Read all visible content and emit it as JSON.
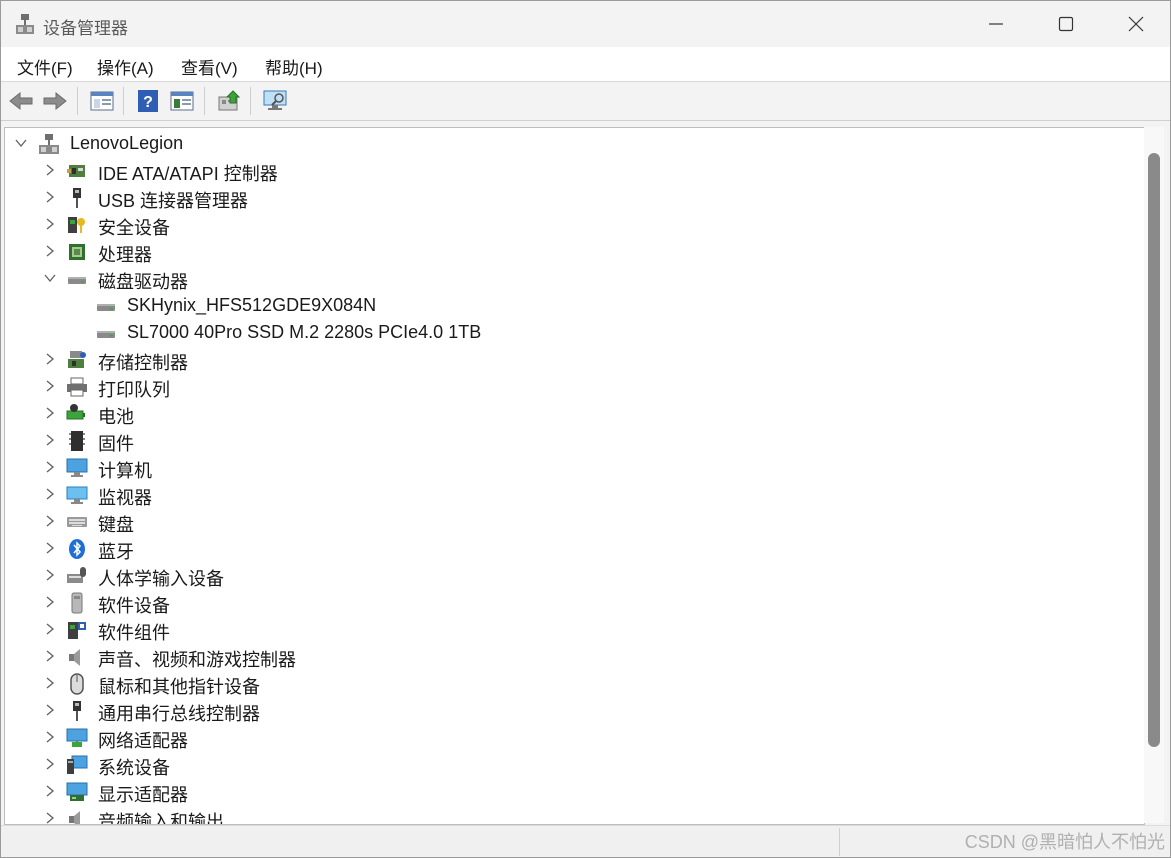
{
  "window": {
    "title": "设备管理器"
  },
  "menu": [
    "文件(F)",
    "操作(A)",
    "查看(V)",
    "帮助(H)"
  ],
  "toolbar": [
    "back-icon",
    "forward-icon",
    "properties-pane-icon",
    "help-icon",
    "console-view-icon",
    "update-driver-icon",
    "scan-hardware-icon"
  ],
  "tree": {
    "root": "LenovoLegion",
    "categories": [
      {
        "label": "IDE ATA/ATAPI 控制器",
        "icon": "ide-controller-icon",
        "expanded": false
      },
      {
        "label": "USB 连接器管理器",
        "icon": "usb-icon",
        "expanded": false
      },
      {
        "label": "安全设备",
        "icon": "security-device-icon",
        "expanded": false
      },
      {
        "label": "处理器",
        "icon": "processor-icon",
        "expanded": false
      },
      {
        "label": "磁盘驱动器",
        "icon": "disk-drive-icon",
        "expanded": true,
        "children": [
          "SKHynix_HFS512GDE9X084N",
          "SL7000 40Pro SSD M.2 2280s PCIe4.0 1TB"
        ]
      },
      {
        "label": "存储控制器",
        "icon": "storage-controller-icon",
        "expanded": false
      },
      {
        "label": "打印队列",
        "icon": "printer-icon",
        "expanded": false
      },
      {
        "label": "电池",
        "icon": "battery-icon",
        "expanded": false
      },
      {
        "label": "固件",
        "icon": "firmware-icon",
        "expanded": false
      },
      {
        "label": "计算机",
        "icon": "computer-icon",
        "expanded": false
      },
      {
        "label": "监视器",
        "icon": "monitor-icon",
        "expanded": false
      },
      {
        "label": "键盘",
        "icon": "keyboard-icon",
        "expanded": false
      },
      {
        "label": "蓝牙",
        "icon": "bluetooth-icon",
        "expanded": false
      },
      {
        "label": "人体学输入设备",
        "icon": "hid-icon",
        "expanded": false
      },
      {
        "label": "软件设备",
        "icon": "software-device-icon",
        "expanded": false
      },
      {
        "label": "软件组件",
        "icon": "software-component-icon",
        "expanded": false
      },
      {
        "label": "声音、视频和游戏控制器",
        "icon": "sound-icon",
        "expanded": false
      },
      {
        "label": "鼠标和其他指针设备",
        "icon": "mouse-icon",
        "expanded": false
      },
      {
        "label": "通用串行总线控制器",
        "icon": "usb-controller-icon",
        "expanded": false
      },
      {
        "label": "网络适配器",
        "icon": "network-adapter-icon",
        "expanded": false
      },
      {
        "label": "系统设备",
        "icon": "system-device-icon",
        "expanded": false
      },
      {
        "label": "显示适配器",
        "icon": "display-adapter-icon",
        "expanded": false
      },
      {
        "label": "音频输入和输出",
        "icon": "audio-io-icon",
        "expanded": false
      }
    ]
  },
  "watermark": "CSDN @黑暗怕人不怕光"
}
